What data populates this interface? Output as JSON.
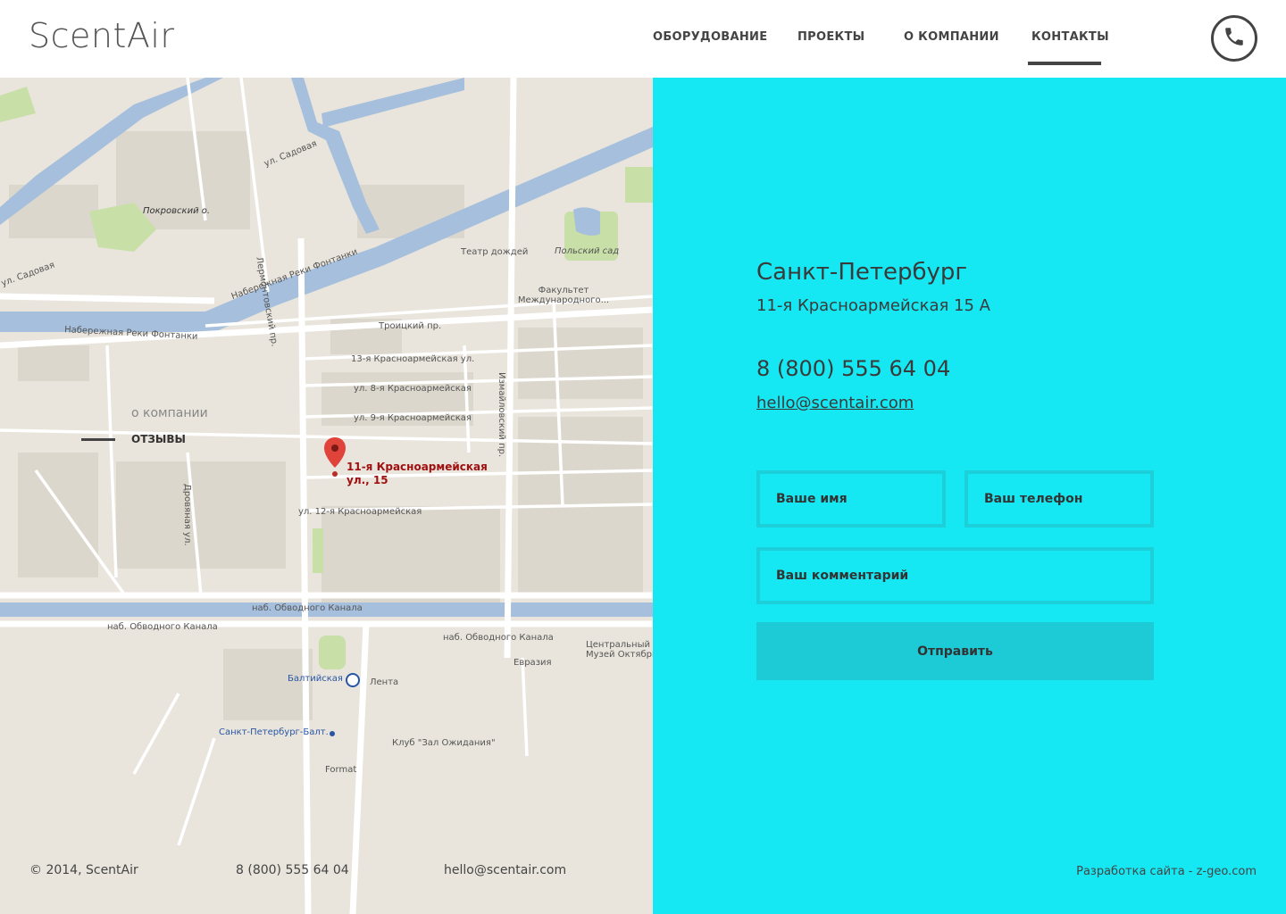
{
  "header": {
    "logo": "ScentAir",
    "nav": [
      {
        "label": "ОБОРУДОВАНИЕ"
      },
      {
        "label": "ПРОЕКТЫ"
      },
      {
        "label": "О КОМПАНИИ"
      },
      {
        "label": "КОНТАКТЫ"
      }
    ],
    "active_nav": "КОНТАКТЫ"
  },
  "map": {
    "overlay": {
      "about": "о компании",
      "reviews": "ОТЗЫВЫ"
    },
    "pin_label_line1": "11-я Красноармейская",
    "pin_label_line2": "ул., 15",
    "labels": [
      "Набережная Реки Фонтанки",
      "ул. Садовая",
      "Покровский о.",
      "Лермонтовский пр.",
      "Театр дождей",
      "Польский сад",
      "Факультет Международного...",
      "Троицкий пр.",
      "13-я Красноармейская ул.",
      "ул. 8-я Красноармейская",
      "ул. 9-я Красноармейская",
      "ул. 12-я Красноармейская",
      "Измайловский пр.",
      "наб. Обводного Канала",
      "Балтийская",
      "Лента",
      "Евразия",
      "Центральный Музей Октябрь",
      "Санкт-Петербург-Балт.",
      "Клуб \"Зал Ожидания\"",
      "Format",
      "ул. Садовая",
      "Дровяная ул."
    ]
  },
  "contact": {
    "city": "Санкт-Петербург",
    "address": "11-я Красноармейская 15 А",
    "phone": "8 (800) 555 64 04",
    "email": "hello@scentair.com"
  },
  "form": {
    "name_placeholder": "Ваше имя",
    "phone_placeholder": "Ваш телефон",
    "comment_placeholder": "Ваш комментарий",
    "submit_label": "Отправить"
  },
  "footer": {
    "copyright": "© 2014, ScentAir",
    "phone": "8 (800) 555 64 04",
    "email": "hello@scentair.com",
    "credit": "Разработка сайта - z-geo.com"
  },
  "colors": {
    "panel_bg": "#15e8f3",
    "field_border": "#1ccfd9",
    "button_bg": "#1ccbd6",
    "map_bg": "#e9e5dc",
    "water": "#a5bfdd",
    "park": "#c8dfa8",
    "pin": "#e0433a"
  },
  "icons": {
    "phone_button": "phone-icon",
    "pin": "map-pin-icon",
    "metro": "metro-icon"
  }
}
